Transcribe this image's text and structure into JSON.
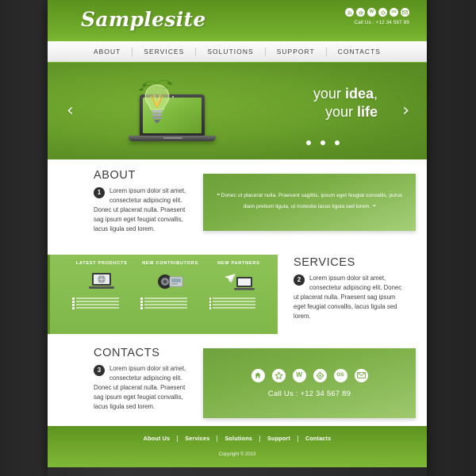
{
  "site": {
    "logo": "Samplesite",
    "header_call": "Call Us : +12 34 567 89",
    "header_social": [
      {
        "name": "rss-icon",
        "glyph": "◉"
      },
      {
        "name": "star-icon",
        "glyph": "★"
      },
      {
        "name": "wordpress-icon",
        "glyph": "W"
      },
      {
        "name": "share-icon",
        "glyph": "◆"
      },
      {
        "name": "os-icon",
        "glyph": "OS"
      },
      {
        "name": "mail-icon",
        "glyph": "✉"
      }
    ]
  },
  "nav": {
    "items": [
      {
        "label": "ABOUT"
      },
      {
        "label": "SERVICES"
      },
      {
        "label": "SOLUTIONS"
      },
      {
        "label": "SUPPORT"
      },
      {
        "label": "CONTACTS"
      }
    ]
  },
  "hero": {
    "line1_light": "your ",
    "line1_bold": "idea",
    "line1_tail": ",",
    "line2_light": "your ",
    "line2_bold": "life",
    "prev_arrow": "‹",
    "next_arrow": "›",
    "dots": 3,
    "active_dot": 0
  },
  "about": {
    "title": "ABOUT",
    "number": "1",
    "text": "Lorem ipsum dolor sit amet, consectetur adipiscing elit. Donec ut placerat nulla. Praesent sag ipsum eget feugiat convallis, lacus ligula sed lorem.",
    "quote_open": "”",
    "quote_close": "”",
    "quote": "Donec ut placerat nulla. Praesent sagittis, ipsum eget feugiat convallis, purus diam pretium ligula, ut molestie lacus ligula sed lorem."
  },
  "products": {
    "columns": [
      {
        "title": "LATEST PRODUCTS",
        "icon": "laptop-globe-icon",
        "bullets": 4
      },
      {
        "title": "NEW CONTRIBUTORS",
        "icon": "camera-photo-icon",
        "bullets": 4
      },
      {
        "title": "NEW PARTNERS",
        "icon": "paperplane-laptop-icon",
        "bullets": 4
      }
    ]
  },
  "services": {
    "title": "SERVICES",
    "number": "2",
    "text": "Lorem ipsum dolor sit amet, consectetur adipiscing elit. Donec ut placerat nulla. Praesent sag ipsum eget feugiat convallis, lacus ligula sed lorem."
  },
  "contacts": {
    "title": "CONTACTS",
    "number": "3",
    "text": "Lorem ipsum dolor sit amet, consectetur adipiscing elit. Donec ut placerat nulla. Praesent sag ipsum eget feugiat convallis, lacus ligula sed lorem.",
    "call": "Call Us : +12 34 567 89",
    "social": [
      {
        "name": "home-icon",
        "glyph": "⌂"
      },
      {
        "name": "star-icon",
        "glyph": "☆"
      },
      {
        "name": "wordpress-icon",
        "glyph": "W"
      },
      {
        "name": "share-icon",
        "glyph": "◇"
      },
      {
        "name": "os-icon",
        "glyph": "OS"
      },
      {
        "name": "mail-icon",
        "glyph": "✉"
      }
    ]
  },
  "footer": {
    "links": [
      {
        "label": "About Us"
      },
      {
        "label": "Services"
      },
      {
        "label": "Solutions"
      },
      {
        "label": "Support"
      },
      {
        "label": "Contacts"
      }
    ],
    "copyright": "Copyright © 2013"
  },
  "colors": {
    "brand_green": "#6aa329",
    "light_green": "#8cc256",
    "dark_bg": "#2c2c2c",
    "text_dark": "#3d3d3d"
  }
}
